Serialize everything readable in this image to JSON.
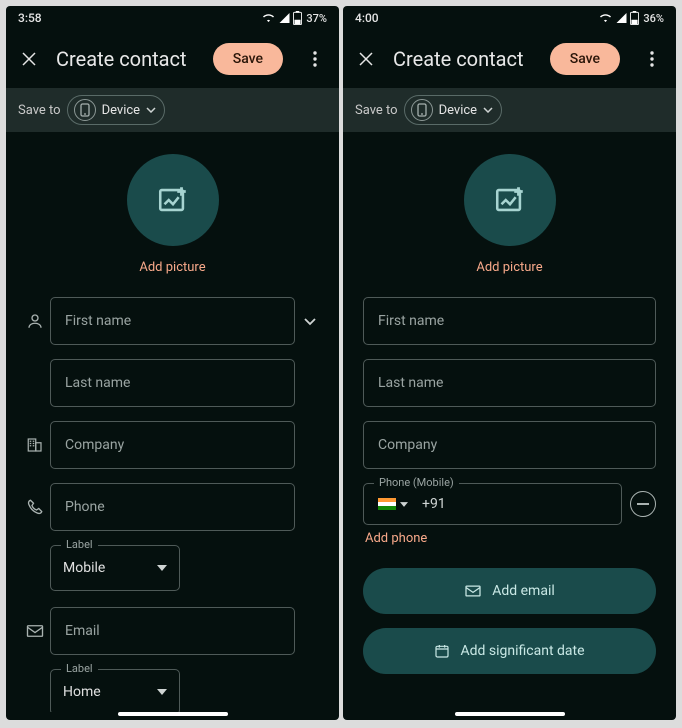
{
  "left": {
    "status": {
      "time": "3:58",
      "battery": "37%"
    },
    "appbar": {
      "title": "Create contact",
      "save": "Save"
    },
    "saveto": {
      "label": "Save to",
      "chip": "Device"
    },
    "picture": {
      "link": "Add picture"
    },
    "fields": {
      "first_name": "First name",
      "last_name": "Last name",
      "company": "Company",
      "phone": "Phone",
      "email": "Email",
      "label_phone": {
        "label": "Label",
        "value": "Mobile"
      },
      "label_email": {
        "label": "Label",
        "value": "Home"
      }
    }
  },
  "right": {
    "status": {
      "time": "4:00",
      "battery": "36%"
    },
    "appbar": {
      "title": "Create contact",
      "save": "Save"
    },
    "saveto": {
      "label": "Save to",
      "chip": "Device"
    },
    "picture": {
      "link": "Add picture"
    },
    "fields": {
      "first_name": "First name",
      "last_name": "Last name",
      "company": "Company",
      "phone_legend": "Phone (Mobile)",
      "dial_code": "+91",
      "add_phone": "Add phone",
      "add_email": "Add email",
      "add_date": "Add significant date"
    }
  }
}
